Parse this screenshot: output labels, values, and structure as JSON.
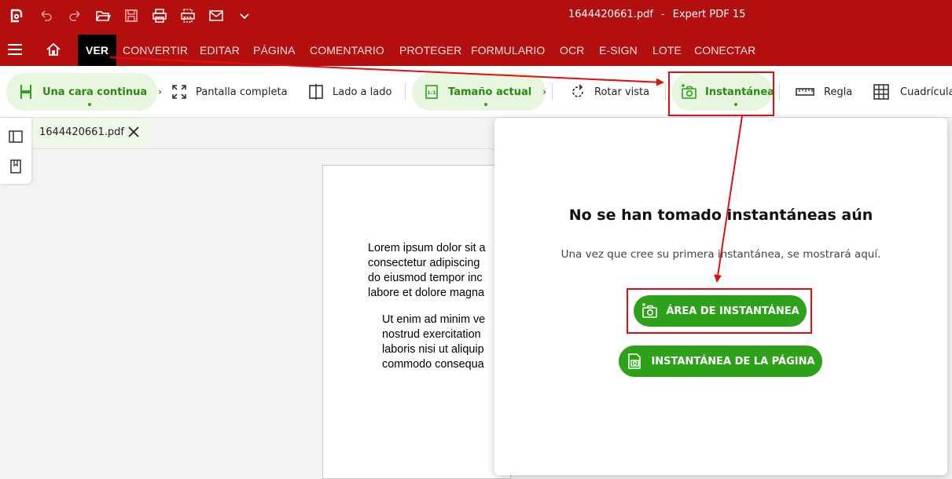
{
  "window": {
    "file": "1644420661.pdf",
    "separator": "-",
    "app": "Expert PDF 15"
  },
  "quick_access": [
    "app-logo-icon",
    "undo-icon",
    "redo-icon",
    "open-folder-icon",
    "save-icon",
    "print-icon",
    "print-setup-icon",
    "mail-icon",
    "chevron-down-icon"
  ],
  "ribbon": {
    "tabs": [
      "VER",
      "CONVERTIR",
      "EDITAR",
      "PÁGINA",
      "COMENTARIO",
      "PROTEGER",
      "FORMULARIO",
      "OCR",
      "E-SIGN",
      "LOTE",
      "CONECTAR"
    ],
    "active_tab": "VER"
  },
  "toolbar": {
    "single_continuous": "Una cara continua",
    "full_screen": "Pantalla completa",
    "side_by_side": "Lado a lado",
    "actual_size": "Tamaño actual",
    "rotate_view": "Rotar vista",
    "snapshot": "Instantánea",
    "ruler": "Regla",
    "grid": "Cuadrícula",
    "chevron": "›"
  },
  "document": {
    "tab_name": "1644420661.pdf",
    "lines": [
      "Lorem ipsum dolor sit a",
      "consectetur adipiscing",
      "do eiusmod tempor inc",
      "labore et dolore magna"
    ],
    "indented_lines": [
      "Ut enim ad minim ve",
      "nostrud exercitation",
      "laboris nisi ut aliquip",
      "commodo consequa"
    ]
  },
  "snapshot_panel": {
    "title": "No se han tomado instantáneas aún",
    "subtitle": "Una vez que cree su primera instantánea, se mostrará aquí.",
    "area_button": "ÁREA DE INSTANTÁNEA",
    "page_button": "INSTANTÁNEA DE LA PÁGINA"
  },
  "colors": {
    "brand_red": "#b30f0f",
    "active_tab": "#000000",
    "accent_green": "#2ea11a",
    "highlight_green_bg": "#e8f6e0",
    "annotation_red": "#e01010"
  }
}
